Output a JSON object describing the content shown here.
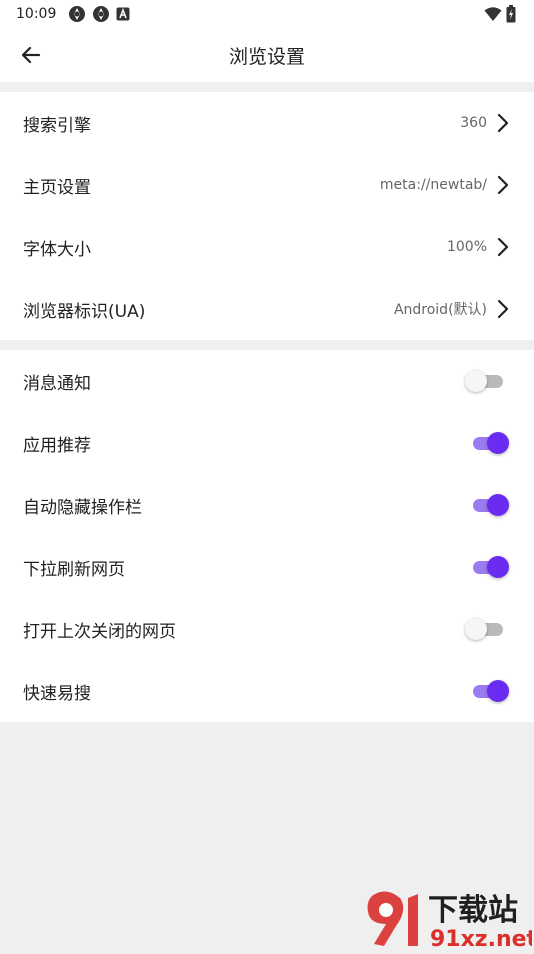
{
  "status": {
    "time": "10:09",
    "icons": [
      "sync-icon",
      "sync-icon",
      "a-notification-icon"
    ],
    "right_icons": [
      "wifi-icon",
      "battery-icon"
    ]
  },
  "appbar": {
    "title": "浏览设置",
    "back_icon": "arrow-left-icon"
  },
  "general": [
    {
      "label": "搜索引擎",
      "value": "360"
    },
    {
      "label": "主页设置",
      "value": "meta://newtab/"
    },
    {
      "label": "字体大小",
      "value": "100%"
    },
    {
      "label": "浏览器标识(UA)",
      "value": "Android(默认)"
    }
  ],
  "toggles": [
    {
      "label": "消息通知",
      "on": false
    },
    {
      "label": "应用推荐",
      "on": true
    },
    {
      "label": "自动隐藏操作栏",
      "on": true
    },
    {
      "label": "下拉刷新网页",
      "on": true
    },
    {
      "label": "打开上次关闭的网页",
      "on": false
    },
    {
      "label": "快速易搜",
      "on": true
    }
  ],
  "watermark": {
    "brand": "下载站",
    "site": "91xz.net",
    "logo_text": "91"
  },
  "colors": {
    "accent": "#6b2cf2",
    "accent_track": "#9b7cf0",
    "divider_bg": "#efefef"
  }
}
